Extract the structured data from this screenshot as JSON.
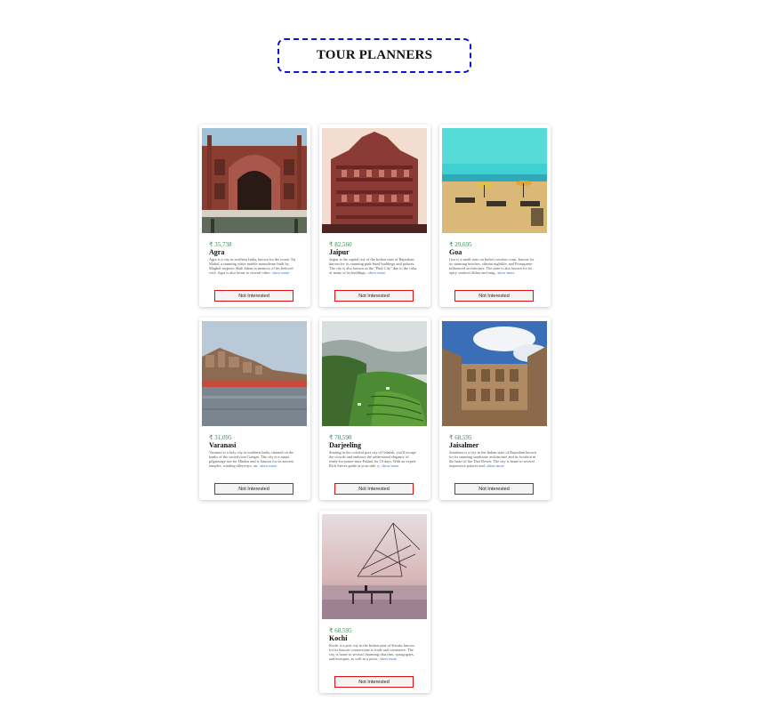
{
  "header": {
    "title": "TOUR PLANNERS"
  },
  "tours": [
    {
      "price": "₹ 35,738",
      "name": "Agra",
      "description": "Agra is a city in northern India, known for the iconic Taj Mahal, a stunning white marble mausoleum built by Mughal emperor Shah Jahan in memory of his beloved wife. Agra is also home to several other",
      "more": "...show more",
      "button": "Not Interested",
      "image": "agra-photo"
    },
    {
      "price": "₹ 82,560",
      "name": "Jaipur",
      "description": "Jaipur is the capital city of the Indian state of Rajasthan, known for its stunning pink-hued buildings and palaces. The city is also known as the \"Pink City\" due to the color of many of its buildings",
      "more": "...show more",
      "button": "Not Interested",
      "image": "jaipur-photo"
    },
    {
      "price": "₹ 29,695",
      "name": "Goa",
      "description": "Goa is a small state on India's western coast, known for its stunning beaches, vibrant nightlife, and Portuguese-influenced architecture. The state is also known for its spicy seafood dishes and unig",
      "more": "...show more",
      "button": "Not Interested",
      "image": "goa-photo"
    },
    {
      "price": "₹ 31,095",
      "name": "Varanasi",
      "description": "Varanasi is a holy city in northern India, situated on the banks of the sacred river Ganges. The city is a major pilgrimage site for Hindus and is famous for its ancient temples, winding alleyways, an",
      "more": "...show more",
      "button": "Not Interested",
      "image": "varanasi-photo"
    },
    {
      "price": "₹ 78,598",
      "name": "Darjeeling",
      "description": "Starting in the colorful port city of Gdańsk, you'll escape the crowds and embrace the understated elegance of ready-for-prime-time Poland for 10 days. With an expert Rick Steves guide at your side, y",
      "more": "...show more",
      "button": "Not Interested",
      "image": "darjeeling-photo"
    },
    {
      "price": "₹ 68,595",
      "name": "Jaisalmer",
      "description": "Jaisalmer is a city in the Indian state of Rajasthan known for its stunning sandstone architecture and its location in the heart of the Thar Desert. The city is home to several impressive palaces and",
      "more": "...show more",
      "button": "Not Interested",
      "image": "jaisalmer-photo"
    },
    {
      "price": "₹ 68,595",
      "name": "Kochi",
      "description": "Kochi is a port city in the Indian state of Kerala, known for its historic connections to trade and commerce. The city is home to several charming churches, synagogues, and mosques, as well as a pictu",
      "more": "...show more",
      "button": "Not Interested",
      "image": "kochi-photo"
    }
  ],
  "colors": {
    "title_border": "#1010d8",
    "button_border": "#dd1111",
    "price": "#3a8a5a",
    "link": "#2a6fd6"
  }
}
